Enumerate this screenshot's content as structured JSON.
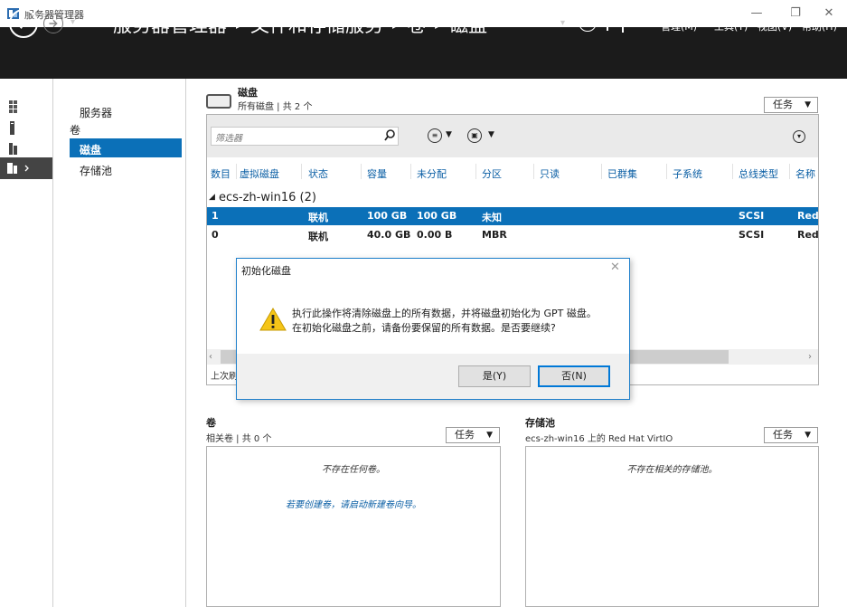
{
  "window": {
    "title": "服务器管理器",
    "controls": {
      "minimize": "—",
      "restore": "❐",
      "close": "✕"
    }
  },
  "header": {
    "breadcrumb": [
      "服务器管理器",
      "文件和存储服务",
      "卷",
      "磁盘"
    ],
    "breadcrumb_sep": "▸",
    "dropdown": "▾",
    "menus": {
      "manage": "管理(M)",
      "tools": "工具(T)",
      "view": "视图(V)",
      "help": "帮助(H)"
    }
  },
  "nav": {
    "items": [
      "服务器",
      "卷",
      "磁盘",
      "存储池"
    ],
    "selected": "磁盘"
  },
  "disks": {
    "title": "磁盘",
    "subtitle": "所有磁盘 | 共 2 个",
    "tasks_label": "任务",
    "filter_placeholder": "筛选器",
    "columns": [
      "数目",
      "虚拟磁盘",
      "状态",
      "容量",
      "未分配",
      "分区",
      "只读",
      "已群集",
      "子系统",
      "总线类型",
      "名称"
    ],
    "group": "ecs-zh-win16 (2)",
    "rows": [
      {
        "number": "1",
        "status": "联机",
        "capacity": "100 GB",
        "unallocated": "100 GB",
        "partition": "未知",
        "bus": "SCSI",
        "name": "Red"
      },
      {
        "number": "0",
        "status": "联机",
        "capacity": "40.0 GB",
        "unallocated": "0.00 B",
        "partition": "MBR",
        "bus": "SCSI",
        "name": "Red"
      }
    ],
    "last_refresh": "上次刷"
  },
  "dialog": {
    "title": "初始化磁盘",
    "message_line1": "执行此操作将清除磁盘上的所有数据，并将磁盘初始化为 GPT 磁盘。",
    "message_line2": "在初始化磁盘之前，请备份要保留的所有数据。是否要继续?",
    "yes_label": "是(Y)",
    "no_label": "否(N)",
    "close": "✕"
  },
  "volumes": {
    "title": "卷",
    "subtitle": "相关卷 | 共 0 个",
    "tasks_label": "任务",
    "empty": "不存在任何卷。",
    "link": "若要创建卷，请启动新建卷向导。"
  },
  "pools": {
    "title": "存储池",
    "subtitle": "ecs-zh-win16 上的 Red Hat VirtIO",
    "tasks_label": "任务",
    "empty": "不存在相关的存储池。"
  },
  "colors": {
    "accent": "#0b70b8",
    "header_bg": "#1b1b1b",
    "link": "#0b5fa5",
    "dialog_border": "#1e7fcb"
  }
}
